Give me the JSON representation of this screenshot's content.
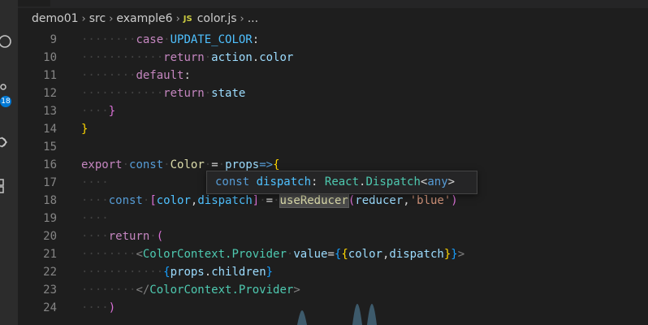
{
  "activity_bar": {
    "icons": [
      "search-icon",
      "source-control-icon",
      "debug-icon",
      "extensions-icon"
    ],
    "badge_count": "18",
    "accent_color": "#0078d4"
  },
  "breadcrumb": {
    "items": [
      "demo01",
      "src",
      "example6"
    ],
    "file_icon": "JS",
    "file_name": "color.js",
    "trailing": "..."
  },
  "editor": {
    "lines": [
      {
        "n": "9",
        "indent": 2,
        "tokens": [
          {
            "t": "case",
            "c": "kw"
          },
          {
            "t": " ",
            "c": "ws"
          },
          {
            "t": "UPDATE_COLOR",
            "c": "const"
          },
          {
            "t": ":",
            "c": "plain"
          }
        ]
      },
      {
        "n": "10",
        "indent": 3,
        "tokens": [
          {
            "t": "return",
            "c": "kw"
          },
          {
            "t": " ",
            "c": "ws"
          },
          {
            "t": "action",
            "c": "var"
          },
          {
            "t": ".",
            "c": "plain"
          },
          {
            "t": "color",
            "c": "var"
          }
        ]
      },
      {
        "n": "11",
        "indent": 2,
        "tokens": [
          {
            "t": "default",
            "c": "kw"
          },
          {
            "t": ":",
            "c": "plain"
          }
        ]
      },
      {
        "n": "12",
        "indent": 3,
        "tokens": [
          {
            "t": "return",
            "c": "kw"
          },
          {
            "t": " ",
            "c": "ws"
          },
          {
            "t": "state",
            "c": "var"
          }
        ]
      },
      {
        "n": "13",
        "indent": 1,
        "tokens": [
          {
            "t": "}",
            "c": "br2"
          }
        ]
      },
      {
        "n": "14",
        "indent": 0,
        "tokens": [
          {
            "t": "}",
            "c": "br1"
          }
        ]
      },
      {
        "n": "15",
        "indent": 0,
        "tokens": []
      },
      {
        "n": "16",
        "indent": 0,
        "tokens": [
          {
            "t": "export",
            "c": "kw"
          },
          {
            "t": " ",
            "c": "ws"
          },
          {
            "t": "const",
            "c": "kwb"
          },
          {
            "t": " ",
            "c": "ws"
          },
          {
            "t": "Color",
            "c": "fn"
          },
          {
            "t": " ",
            "c": "ws"
          },
          {
            "t": "=",
            "c": "plain"
          },
          {
            "t": " ",
            "c": "ws"
          },
          {
            "t": "props",
            "c": "var"
          },
          {
            "t": "=>",
            "c": "kwb"
          },
          {
            "t": "{",
            "c": "br1"
          }
        ]
      },
      {
        "n": "17",
        "indent": 1,
        "tokens": []
      },
      {
        "n": "18",
        "indent": 1,
        "tokens": [
          {
            "t": "const",
            "c": "kwb"
          },
          {
            "t": " ",
            "c": "ws"
          },
          {
            "t": "[",
            "c": "br2"
          },
          {
            "t": "color",
            "c": "const"
          },
          {
            "t": ",",
            "c": "plain"
          },
          {
            "t": "dispatch",
            "c": "const"
          },
          {
            "t": "]",
            "c": "br2"
          },
          {
            "t": " ",
            "c": "ws"
          },
          {
            "t": "=",
            "c": "plain"
          },
          {
            "t": " ",
            "c": "ws"
          },
          {
            "t": "useReducer",
            "c": "fn",
            "hl": true
          },
          {
            "t": "(",
            "c": "br2"
          },
          {
            "t": "reducer",
            "c": "var"
          },
          {
            "t": ",",
            "c": "plain"
          },
          {
            "t": "'blue'",
            "c": "str"
          },
          {
            "t": ")",
            "c": "br2"
          }
        ]
      },
      {
        "n": "19",
        "indent": 1,
        "tokens": []
      },
      {
        "n": "20",
        "indent": 1,
        "tokens": [
          {
            "t": "return",
            "c": "kw"
          },
          {
            "t": " ",
            "c": "ws"
          },
          {
            "t": "(",
            "c": "br2"
          }
        ]
      },
      {
        "n": "21",
        "indent": 2,
        "tokens": [
          {
            "t": "<",
            "c": "brk"
          },
          {
            "t": "ColorContext.Provider",
            "c": "tag"
          },
          {
            "t": " ",
            "c": "ws"
          },
          {
            "t": "value",
            "c": "var"
          },
          {
            "t": "=",
            "c": "plain"
          },
          {
            "t": "{",
            "c": "br3"
          },
          {
            "t": "{",
            "c": "br1"
          },
          {
            "t": "color",
            "c": "var"
          },
          {
            "t": ",",
            "c": "plain"
          },
          {
            "t": "dispatch",
            "c": "var"
          },
          {
            "t": "}",
            "c": "br1"
          },
          {
            "t": "}",
            "c": "br3"
          },
          {
            "t": ">",
            "c": "brk"
          }
        ]
      },
      {
        "n": "22",
        "indent": 3,
        "tokens": [
          {
            "t": "{",
            "c": "br3"
          },
          {
            "t": "props",
            "c": "var"
          },
          {
            "t": ".",
            "c": "plain"
          },
          {
            "t": "children",
            "c": "var"
          },
          {
            "t": "}",
            "c": "br3"
          }
        ]
      },
      {
        "n": "23",
        "indent": 2,
        "tokens": [
          {
            "t": "</",
            "c": "brk"
          },
          {
            "t": "ColorContext.Provider",
            "c": "tag"
          },
          {
            "t": ">",
            "c": "brk"
          }
        ]
      },
      {
        "n": "24",
        "indent": 1,
        "tokens": [
          {
            "t": ")",
            "c": "br2"
          }
        ]
      }
    ]
  },
  "hover_tooltip": {
    "tokens": [
      {
        "t": "const",
        "c": "kwb"
      },
      {
        "t": " ",
        "c": "plain"
      },
      {
        "t": "dispatch",
        "c": "const"
      },
      {
        "t": ": ",
        "c": "plain"
      },
      {
        "t": "React",
        "c": "tag"
      },
      {
        "t": ".",
        "c": "plain"
      },
      {
        "t": "Dispatch",
        "c": "tag"
      },
      {
        "t": "<",
        "c": "plain"
      },
      {
        "t": "any",
        "c": "kwb"
      },
      {
        "t": ">",
        "c": "plain"
      }
    ]
  },
  "colors": {
    "background": "#1e1e1e",
    "keyword": "#c586c0",
    "storage": "#569cd6",
    "function": "#dcdcaa",
    "string": "#ce9178",
    "type": "#4ec9b0"
  }
}
